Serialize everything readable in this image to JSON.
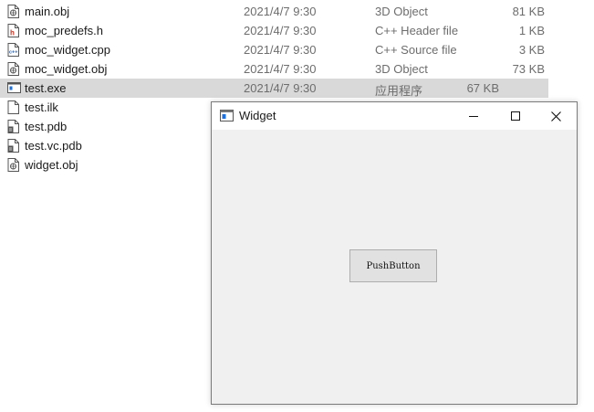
{
  "explorer": {
    "files": [
      {
        "name": "main.obj",
        "date": "2021/4/7 9:30",
        "type": "3D Object",
        "size": "81 KB",
        "icon": "obj-file-icon",
        "selected": false
      },
      {
        "name": "moc_predefs.h",
        "date": "2021/4/7 9:30",
        "type": "C++ Header file",
        "size": "1 KB",
        "icon": "header-file-icon",
        "selected": false
      },
      {
        "name": "moc_widget.cpp",
        "date": "2021/4/7 9:30",
        "type": "C++ Source file",
        "size": "3 KB",
        "icon": "cpp-file-icon",
        "selected": false
      },
      {
        "name": "moc_widget.obj",
        "date": "2021/4/7 9:30",
        "type": "3D Object",
        "size": "73 KB",
        "icon": "obj-file-icon",
        "selected": false
      },
      {
        "name": "test.exe",
        "date": "2021/4/7 9:30",
        "type": "应用程序",
        "size": "67 KB",
        "icon": "exe-file-icon",
        "selected": true
      },
      {
        "name": "test.ilk",
        "date": "",
        "type": "",
        "size": "",
        "icon": "generic-file-icon",
        "selected": false
      },
      {
        "name": "test.pdb",
        "date": "",
        "type": "",
        "size": "",
        "icon": "pdb-file-icon",
        "selected": false
      },
      {
        "name": "test.vc.pdb",
        "date": "",
        "type": "",
        "size": "",
        "icon": "pdb-file-icon",
        "selected": false
      },
      {
        "name": "widget.obj",
        "date": "",
        "type": "",
        "size": "",
        "icon": "obj-file-icon",
        "selected": false
      }
    ]
  },
  "window": {
    "title": "Widget",
    "icon": "qt-window-icon",
    "minimize_icon": "minimize-icon",
    "maximize_icon": "maximize-icon",
    "close_icon": "close-icon",
    "push_button_label": "PushButton"
  },
  "colors": {
    "selection": "#d9d9d9",
    "window_background": "#f0f0f0",
    "button_face": "#e1e1e1",
    "button_border": "#adadad",
    "header_icon_accent": "#c0392b",
    "exe_icon_accent": "#1e6fd9"
  }
}
